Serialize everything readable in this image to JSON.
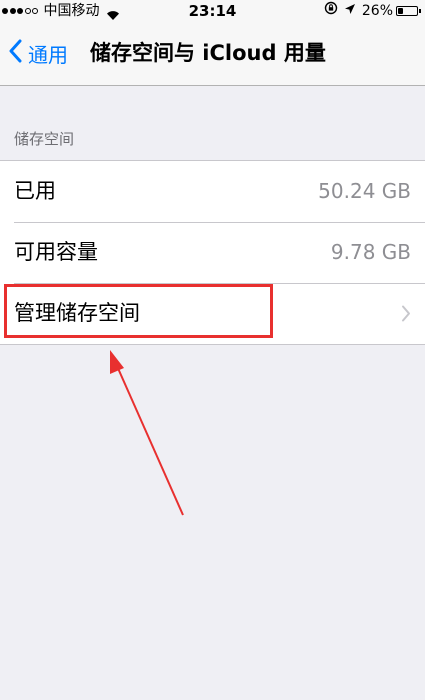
{
  "status_bar": {
    "carrier": "中国移动",
    "time": "23:14",
    "battery_percent": "26%",
    "battery_level": 0.26,
    "signal_bars": 3,
    "signal_total": 5,
    "icons": [
      "wifi-icon",
      "orientation-lock-icon",
      "location-icon",
      "battery-icon"
    ]
  },
  "nav": {
    "back_label": "通用",
    "title": "储存空间与 iCloud 用量"
  },
  "storage": {
    "section_header": "储存空间",
    "rows": [
      {
        "label": "已用",
        "value": "50.24 GB"
      },
      {
        "label": "可用容量",
        "value": "9.78 GB"
      },
      {
        "label": "管理储存空间",
        "value": ""
      }
    ]
  },
  "annotation": {
    "color": "#e8302f"
  },
  "colors": {
    "accent": "#007aff",
    "background": "#efeff4",
    "secondary_text": "#8e8e93"
  }
}
